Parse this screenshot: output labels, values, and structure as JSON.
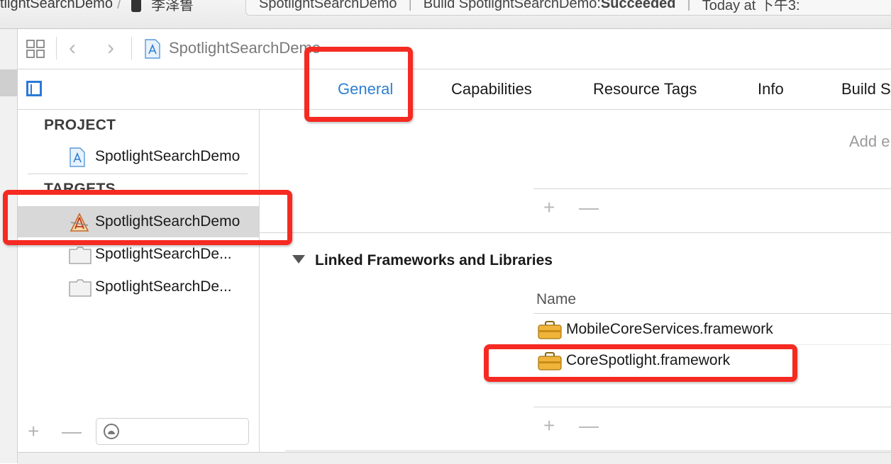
{
  "activity_bar": {
    "scheme_name": "tlightSearchDemo",
    "device_name": "李泽鲁",
    "status_project": "SpotlightSearchDemo",
    "status_build_prefix": "Build SpotlightSearchDemo: ",
    "status_build_result": "Succeeded",
    "status_time": "Today at 下午3:"
  },
  "jump_bar": {
    "project_name": "SpotlightSearchDemo"
  },
  "tabs": [
    {
      "label": "General",
      "active": true
    },
    {
      "label": "Capabilities"
    },
    {
      "label": "Resource Tags"
    },
    {
      "label": "Info"
    },
    {
      "label": "Build S"
    }
  ],
  "sidebar": {
    "project_header": "PROJECT",
    "project_item": "SpotlightSearchDemo",
    "targets_header": "TARGETS",
    "targets": [
      {
        "label": "SpotlightSearchDemo",
        "icon": "app-target-icon",
        "selected": true
      },
      {
        "label": "SpotlightSearchDe...",
        "icon": "test-bundle-icon"
      },
      {
        "label": "SpotlightSearchDe...",
        "icon": "test-bundle-icon"
      }
    ],
    "add_label": "+",
    "remove_label": "—"
  },
  "main": {
    "add_text": "Add e",
    "add_label": "+",
    "remove_label": "—",
    "section_title": "Linked Frameworks and Libraries",
    "column_name": "Name",
    "frameworks": [
      {
        "label": "MobileCoreServices.framework",
        "icon": "framework-toolbox-icon"
      },
      {
        "label": "CoreSpotlight.framework",
        "icon": "framework-toolbox-icon"
      }
    ]
  },
  "colors": {
    "accent": "#2f7fd2",
    "annotation": "#f52a22",
    "selection": "#d8d8d8"
  }
}
